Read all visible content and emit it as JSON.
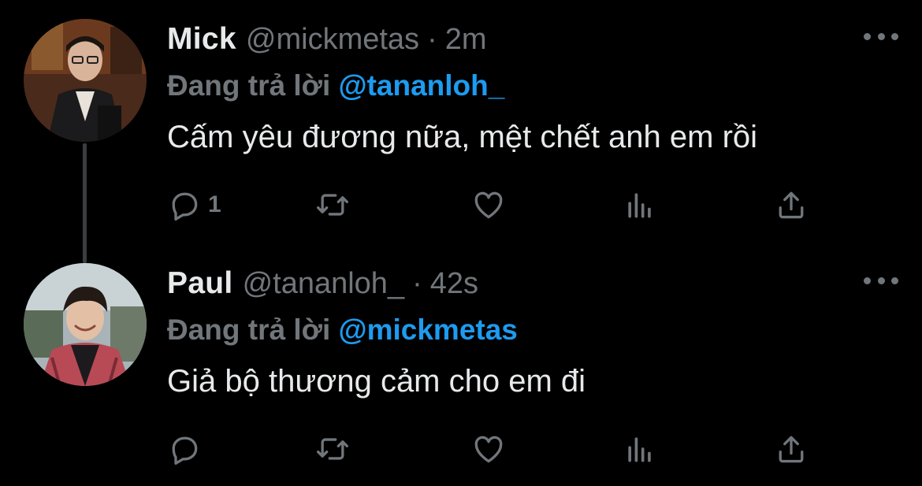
{
  "tweets": [
    {
      "name": "Mick",
      "handle": "@mickmetas",
      "separator": "·",
      "time": "2m",
      "reply_prefix": "Đang trả lời",
      "reply_to": "@tananloh_",
      "text": "Cấm yêu đương nữa, mệt chết anh em rồi",
      "reply_count": "1",
      "icons": {
        "more": "more-horizontal-icon",
        "reply": "speech-bubble-icon",
        "retweet": "retweet-icon",
        "like": "heart-icon",
        "views": "bar-chart-icon",
        "share": "share-upload-icon"
      }
    },
    {
      "name": "Paul",
      "handle": "@tananloh_",
      "separator": "·",
      "time": "42s",
      "reply_prefix": "Đang trả lời",
      "reply_to": "@mickmetas",
      "text": "Giả bộ thương cảm cho em đi",
      "reply_count": "",
      "icons": {
        "more": "more-horizontal-icon",
        "reply": "speech-bubble-icon",
        "retweet": "retweet-icon",
        "like": "heart-icon",
        "views": "bar-chart-icon",
        "share": "share-upload-icon"
      }
    }
  ],
  "colors": {
    "background": "#000000",
    "primary_text": "#e7e9ea",
    "secondary_text": "#71767b",
    "link": "#1d9bf0",
    "thread_line": "#3a3d41"
  }
}
